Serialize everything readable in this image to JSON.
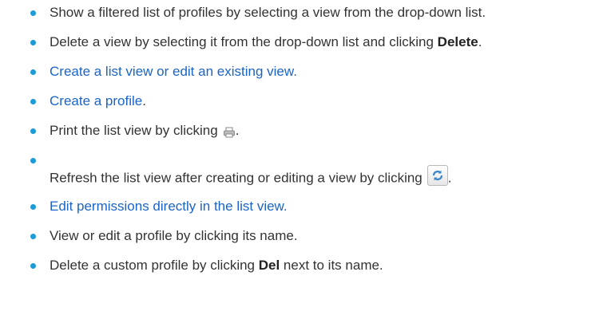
{
  "colors": {
    "bullet": "#1b9bd7",
    "link": "#1a64c8",
    "text": "#333333"
  },
  "items": [
    {
      "text": "Show a filtered list of profiles by selecting a view from the drop-down list."
    },
    {
      "pre": "Delete a view by selecting it from the drop-down list and clicking ",
      "bold": "Delete",
      "post": "."
    },
    {
      "link": "Create a list view or edit an existing view."
    },
    {
      "link_pre": "Create a profile",
      "post": "."
    },
    {
      "pre": "Print the list view by clicking",
      "post": ".",
      "icon": "printer-icon"
    },
    {
      "pre": "Refresh the list view after creating or editing a view by clicking",
      "post": ".",
      "icon": "refresh-icon"
    },
    {
      "link": "Edit permissions directly in the list view."
    },
    {
      "text": "View or edit a profile by clicking its name."
    },
    {
      "pre": "Delete a custom profile by clicking ",
      "bold": "Del",
      "post": " next to its name."
    }
  ]
}
